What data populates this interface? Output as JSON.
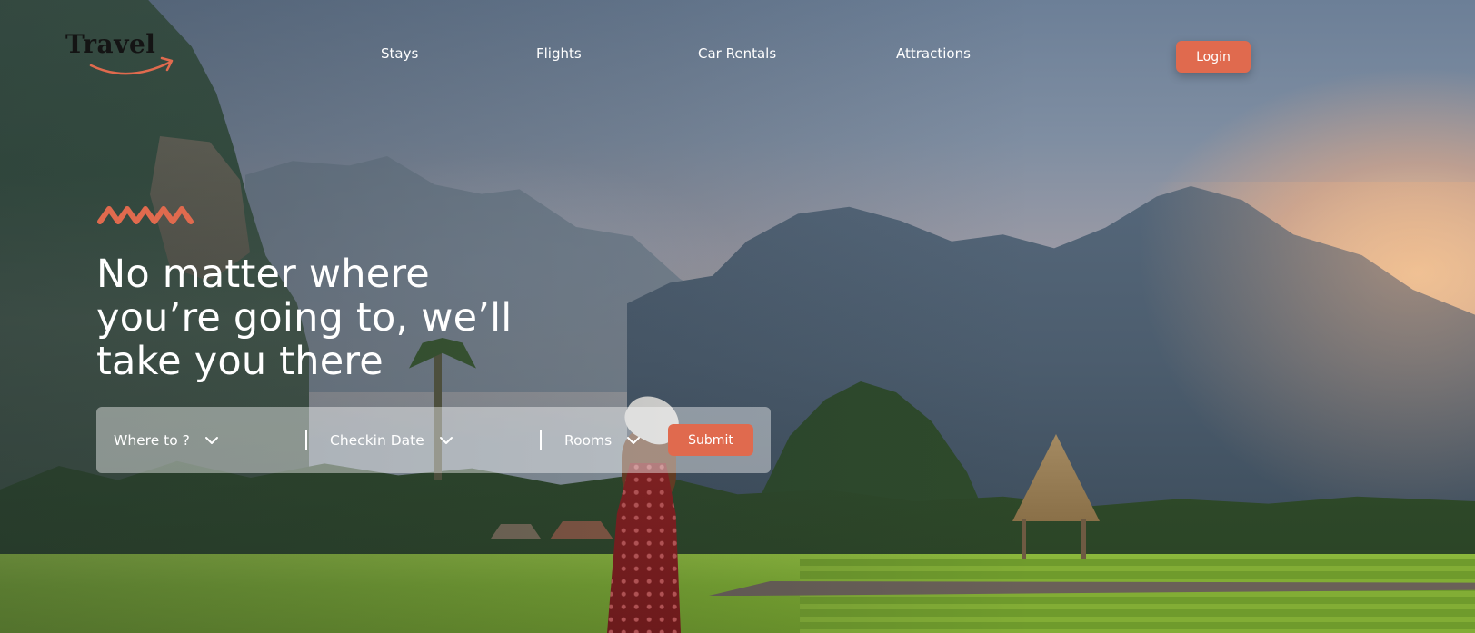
{
  "brand": {
    "logo_text": "Travel",
    "accent_color": "#e06a4e"
  },
  "nav": {
    "items": [
      {
        "label": "Stays"
      },
      {
        "label": "Flights"
      },
      {
        "label": "Car Rentals"
      },
      {
        "label": "Attractions"
      }
    ],
    "login_label": "Login"
  },
  "hero": {
    "headline_lines": [
      "No matter where",
      "you’re going to, we’ll",
      "take you there"
    ],
    "decoration_icon": "zigzag-wave-icon"
  },
  "search": {
    "destination_label": "Where to ?",
    "checkin_label": "Checkin Date",
    "rooms_label": "Rooms",
    "submit_label": "Submit",
    "dropdown_icon": "chevron-down-icon"
  }
}
